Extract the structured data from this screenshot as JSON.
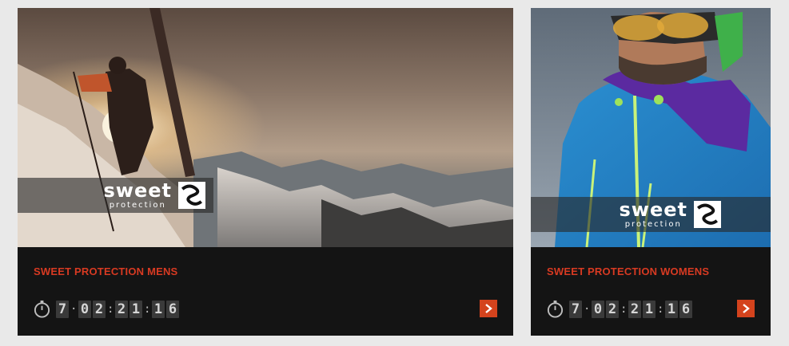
{
  "products": [
    {
      "title": "SWEET PROTECTION MENS",
      "brand": {
        "word": "sweet",
        "sub": "protection"
      },
      "countdown": {
        "d": "7",
        "h1": "0",
        "h2": "2",
        "m1": "2",
        "m2": "1",
        "s1": "1",
        "s2": "6",
        "sep_day": "·",
        "sep": ":"
      },
      "arrow_icon": "chevron-right-icon"
    },
    {
      "title": "SWEET PROTECTION WOMENS",
      "brand": {
        "word": "sweet",
        "sub": "protection"
      },
      "countdown": {
        "d": "7",
        "h1": "0",
        "h2": "2",
        "m1": "2",
        "m2": "1",
        "s1": "1",
        "s2": "6",
        "sep_day": "·",
        "sep": ":"
      },
      "arrow_icon": "chevron-right-icon"
    }
  ],
  "colors": {
    "accent": "#d83a22",
    "button": "#d4431d",
    "card_bg": "#141414",
    "page_bg": "#e9e9e9"
  }
}
